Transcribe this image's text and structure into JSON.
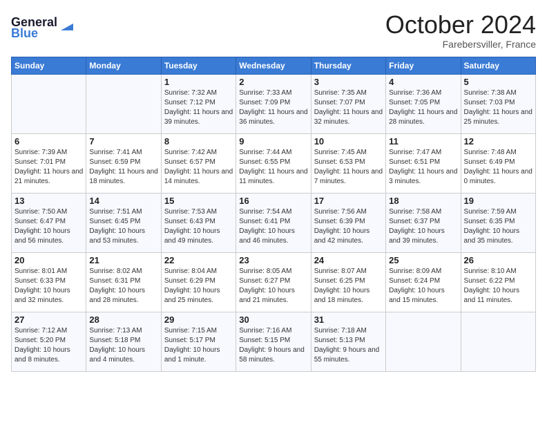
{
  "header": {
    "logo_line1": "General",
    "logo_line2": "Blue",
    "month": "October 2024",
    "location": "Farebersviller, France"
  },
  "weekdays": [
    "Sunday",
    "Monday",
    "Tuesday",
    "Wednesday",
    "Thursday",
    "Friday",
    "Saturday"
  ],
  "weeks": [
    [
      {
        "day": "",
        "info": ""
      },
      {
        "day": "",
        "info": ""
      },
      {
        "day": "1",
        "info": "Sunrise: 7:32 AM\nSunset: 7:12 PM\nDaylight: 11 hours and 39 minutes."
      },
      {
        "day": "2",
        "info": "Sunrise: 7:33 AM\nSunset: 7:09 PM\nDaylight: 11 hours and 36 minutes."
      },
      {
        "day": "3",
        "info": "Sunrise: 7:35 AM\nSunset: 7:07 PM\nDaylight: 11 hours and 32 minutes."
      },
      {
        "day": "4",
        "info": "Sunrise: 7:36 AM\nSunset: 7:05 PM\nDaylight: 11 hours and 28 minutes."
      },
      {
        "day": "5",
        "info": "Sunrise: 7:38 AM\nSunset: 7:03 PM\nDaylight: 11 hours and 25 minutes."
      }
    ],
    [
      {
        "day": "6",
        "info": "Sunrise: 7:39 AM\nSunset: 7:01 PM\nDaylight: 11 hours and 21 minutes."
      },
      {
        "day": "7",
        "info": "Sunrise: 7:41 AM\nSunset: 6:59 PM\nDaylight: 11 hours and 18 minutes."
      },
      {
        "day": "8",
        "info": "Sunrise: 7:42 AM\nSunset: 6:57 PM\nDaylight: 11 hours and 14 minutes."
      },
      {
        "day": "9",
        "info": "Sunrise: 7:44 AM\nSunset: 6:55 PM\nDaylight: 11 hours and 11 minutes."
      },
      {
        "day": "10",
        "info": "Sunrise: 7:45 AM\nSunset: 6:53 PM\nDaylight: 11 hours and 7 minutes."
      },
      {
        "day": "11",
        "info": "Sunrise: 7:47 AM\nSunset: 6:51 PM\nDaylight: 11 hours and 3 minutes."
      },
      {
        "day": "12",
        "info": "Sunrise: 7:48 AM\nSunset: 6:49 PM\nDaylight: 11 hours and 0 minutes."
      }
    ],
    [
      {
        "day": "13",
        "info": "Sunrise: 7:50 AM\nSunset: 6:47 PM\nDaylight: 10 hours and 56 minutes."
      },
      {
        "day": "14",
        "info": "Sunrise: 7:51 AM\nSunset: 6:45 PM\nDaylight: 10 hours and 53 minutes."
      },
      {
        "day": "15",
        "info": "Sunrise: 7:53 AM\nSunset: 6:43 PM\nDaylight: 10 hours and 49 minutes."
      },
      {
        "day": "16",
        "info": "Sunrise: 7:54 AM\nSunset: 6:41 PM\nDaylight: 10 hours and 46 minutes."
      },
      {
        "day": "17",
        "info": "Sunrise: 7:56 AM\nSunset: 6:39 PM\nDaylight: 10 hours and 42 minutes."
      },
      {
        "day": "18",
        "info": "Sunrise: 7:58 AM\nSunset: 6:37 PM\nDaylight: 10 hours and 39 minutes."
      },
      {
        "day": "19",
        "info": "Sunrise: 7:59 AM\nSunset: 6:35 PM\nDaylight: 10 hours and 35 minutes."
      }
    ],
    [
      {
        "day": "20",
        "info": "Sunrise: 8:01 AM\nSunset: 6:33 PM\nDaylight: 10 hours and 32 minutes."
      },
      {
        "day": "21",
        "info": "Sunrise: 8:02 AM\nSunset: 6:31 PM\nDaylight: 10 hours and 28 minutes."
      },
      {
        "day": "22",
        "info": "Sunrise: 8:04 AM\nSunset: 6:29 PM\nDaylight: 10 hours and 25 minutes."
      },
      {
        "day": "23",
        "info": "Sunrise: 8:05 AM\nSunset: 6:27 PM\nDaylight: 10 hours and 21 minutes."
      },
      {
        "day": "24",
        "info": "Sunrise: 8:07 AM\nSunset: 6:25 PM\nDaylight: 10 hours and 18 minutes."
      },
      {
        "day": "25",
        "info": "Sunrise: 8:09 AM\nSunset: 6:24 PM\nDaylight: 10 hours and 15 minutes."
      },
      {
        "day": "26",
        "info": "Sunrise: 8:10 AM\nSunset: 6:22 PM\nDaylight: 10 hours and 11 minutes."
      }
    ],
    [
      {
        "day": "27",
        "info": "Sunrise: 7:12 AM\nSunset: 5:20 PM\nDaylight: 10 hours and 8 minutes."
      },
      {
        "day": "28",
        "info": "Sunrise: 7:13 AM\nSunset: 5:18 PM\nDaylight: 10 hours and 4 minutes."
      },
      {
        "day": "29",
        "info": "Sunrise: 7:15 AM\nSunset: 5:17 PM\nDaylight: 10 hours and 1 minute."
      },
      {
        "day": "30",
        "info": "Sunrise: 7:16 AM\nSunset: 5:15 PM\nDaylight: 9 hours and 58 minutes."
      },
      {
        "day": "31",
        "info": "Sunrise: 7:18 AM\nSunset: 5:13 PM\nDaylight: 9 hours and 55 minutes."
      },
      {
        "day": "",
        "info": ""
      },
      {
        "day": "",
        "info": ""
      }
    ]
  ]
}
